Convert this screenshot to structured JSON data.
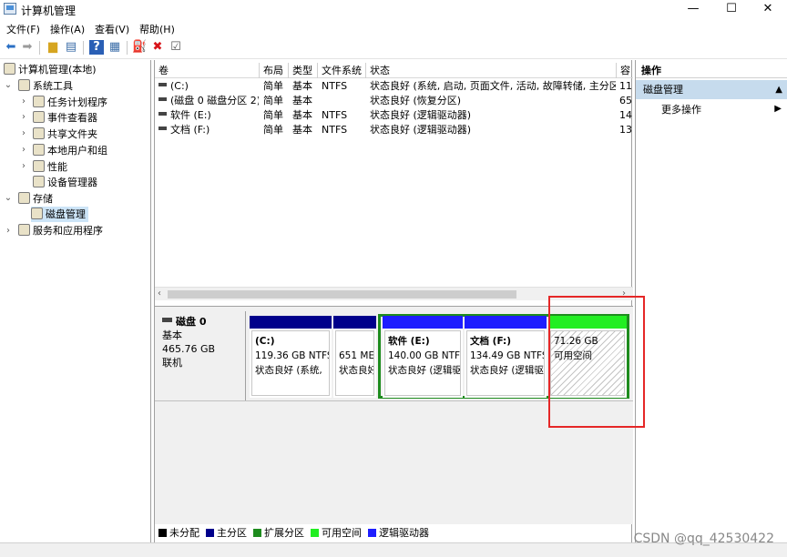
{
  "window": {
    "title": "计算机管理",
    "minimize": "—",
    "maximize": "☐",
    "close": "✕"
  },
  "menu": [
    "文件(F)",
    "操作(A)",
    "查看(V)",
    "帮助(H)"
  ],
  "toolbar_icons": [
    "back-icon",
    "forward-icon",
    "up-folder-icon",
    "show-hide-icon",
    "help-icon",
    "properties-icon",
    "connect-icon",
    "delete-icon",
    "checklist-icon"
  ],
  "tree": {
    "root": "计算机管理(本地)",
    "system_tools": "系统工具",
    "task_scheduler": "任务计划程序",
    "event_viewer": "事件查看器",
    "shared_folders": "共享文件夹",
    "local_users": "本地用户和组",
    "performance": "性能",
    "device_manager": "设备管理器",
    "storage": "存储",
    "disk_management": "磁盘管理",
    "services_apps": "服务和应用程序"
  },
  "volume_table": {
    "headers": [
      "卷",
      "布局",
      "类型",
      "文件系统",
      "状态",
      "容"
    ],
    "rows": [
      {
        "vol": "(C:)",
        "layout": "简单",
        "type": "基本",
        "fs": "NTFS",
        "status": "状态良好 (系统, 启动, 页面文件, 活动, 故障转储, 主分区)",
        "cap": "11"
      },
      {
        "vol": "(磁盘 0 磁盘分区 2)",
        "layout": "简单",
        "type": "基本",
        "fs": "",
        "status": "状态良好 (恢复分区)",
        "cap": "65"
      },
      {
        "vol": "软件 (E:)",
        "layout": "简单",
        "type": "基本",
        "fs": "NTFS",
        "status": "状态良好 (逻辑驱动器)",
        "cap": "14"
      },
      {
        "vol": "文档 (F:)",
        "layout": "简单",
        "type": "基本",
        "fs": "NTFS",
        "status": "状态良好 (逻辑驱动器)",
        "cap": "13"
      }
    ]
  },
  "disk": {
    "name": "磁盘 0",
    "type": "基本",
    "size": "465.76 GB",
    "state": "联机",
    "partitions": [
      {
        "name": "(C:)",
        "size": "119.36 GB NTFS",
        "status": "状态良好 (系统, ",
        "color": "#00008b"
      },
      {
        "name": "",
        "size": "651 ME",
        "status": "状态良好",
        "color": "#00008b"
      },
      {
        "name": "软件  (E:)",
        "size": "140.00 GB NTF",
        "status": "状态良好 (逻辑驱",
        "color": "#1e1eff"
      },
      {
        "name": "文档  (F:)",
        "size": "134.49 GB NTFS",
        "status": "状态良好 (逻辑驱",
        "color": "#1e1eff"
      },
      {
        "name": "",
        "size": "71.26 GB",
        "status": "可用空间",
        "color": "#22ee22"
      }
    ]
  },
  "legend": [
    {
      "label": "未分配",
      "color": "#000000"
    },
    {
      "label": "主分区",
      "color": "#00008b"
    },
    {
      "label": "扩展分区",
      "color": "#1e8c1e"
    },
    {
      "label": "可用空间",
      "color": "#22ee22"
    },
    {
      "label": "逻辑驱动器",
      "color": "#1e1eff"
    }
  ],
  "actions": {
    "title": "操作",
    "section": "磁盘管理",
    "more": "更多操作"
  },
  "watermark": "CSDN @qq_42530422"
}
